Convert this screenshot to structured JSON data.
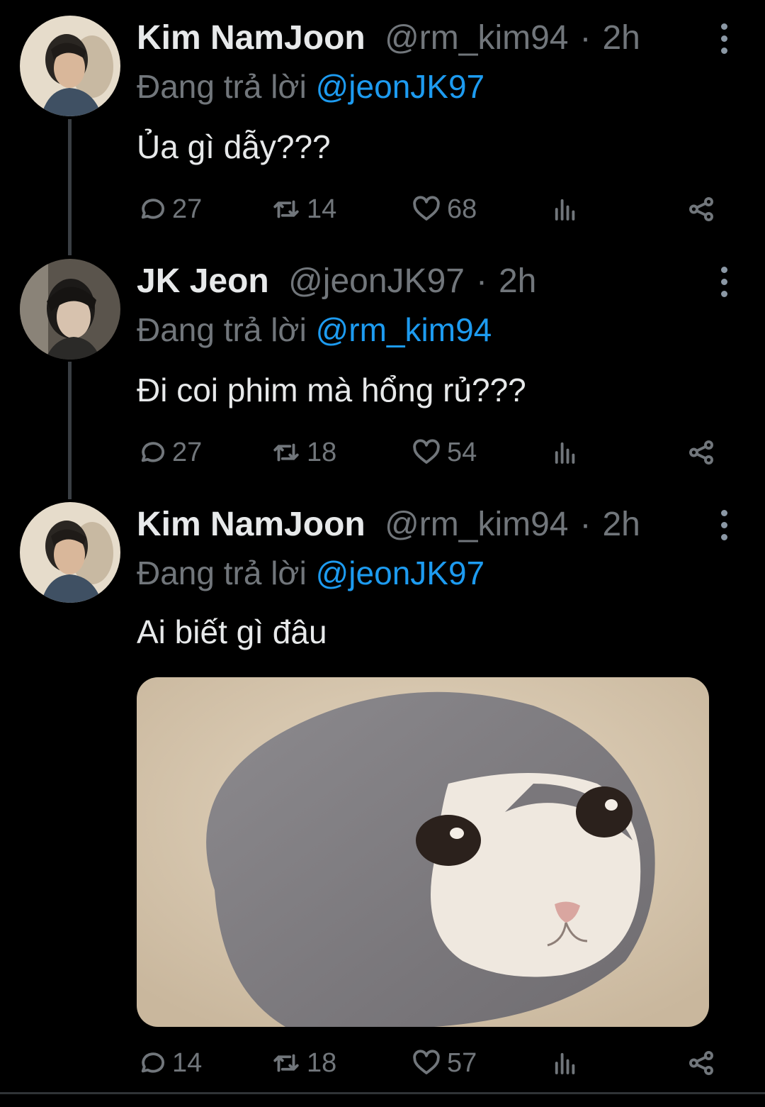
{
  "tweets": [
    {
      "name": "Kim NamJoon",
      "handle": "@rm_kim94",
      "separator": "·",
      "time": "2h",
      "reply_prefix": "Đang trả lời",
      "reply_to": "@jeonJK97",
      "text": "Ủa gì dẫy???",
      "replies": "27",
      "retweets": "14",
      "likes": "68"
    },
    {
      "name": "JK Jeon",
      "handle": "@jeonJK97",
      "separator": "·",
      "time": "2h",
      "reply_prefix": "Đang trả lời",
      "reply_to": "@rm_kim94",
      "text": "Đi coi phim mà hổng rủ???",
      "replies": "27",
      "retweets": "18",
      "likes": "54"
    },
    {
      "name": "Kim NamJoon",
      "handle": "@rm_kim94",
      "separator": "·",
      "time": "2h",
      "reply_prefix": "Đang trả lời",
      "reply_to": "@jeonJK97",
      "text": "Ai biết gì đâu",
      "replies": "14",
      "retweets": "18",
      "likes": "57"
    }
  ],
  "icons": {
    "reply": "speech-bubble-icon",
    "retweet": "retweet-icon",
    "like": "heart-icon",
    "views": "analytics-bars-icon",
    "share": "share-nodes-icon",
    "more": "vertical-ellipsis-icon"
  },
  "colors": {
    "background": "#000000",
    "mention": "#1d9bf0",
    "muted": "#71767b",
    "text": "#e7e9ea"
  }
}
